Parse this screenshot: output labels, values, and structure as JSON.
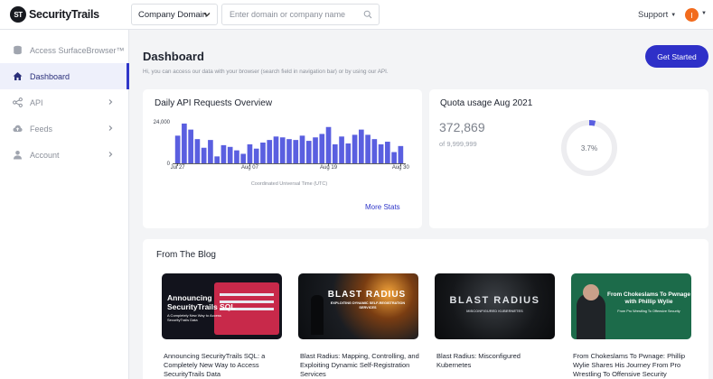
{
  "brand": {
    "name": "SecurityTrails",
    "mark": "ST"
  },
  "header": {
    "search_type": "Company Domain",
    "search_placeholder": "Enter domain or company name",
    "support_label": "Support",
    "avatar_initial": "I"
  },
  "sidebar": {
    "items": [
      {
        "label": "Access SurfaceBrowser™",
        "icon": "database-icon",
        "active": false
      },
      {
        "label": "Dashboard",
        "icon": "home-icon",
        "active": true
      },
      {
        "label": "API",
        "icon": "share-nodes-icon",
        "active": false
      },
      {
        "label": "Feeds",
        "icon": "cloud-upload-icon",
        "active": false
      },
      {
        "label": "Account",
        "icon": "user-icon",
        "active": false
      }
    ]
  },
  "page": {
    "title": "Dashboard",
    "subtitle": "Hi, you can access our data with your browser (search field in navigation bar) or by using our API.",
    "cta": "Get Started"
  },
  "api_card": {
    "title": "Daily API Requests Overview",
    "more_stats": "More Stats"
  },
  "quota_card": {
    "title": "Quota usage Aug 2021",
    "used": "372,869",
    "limit": "of 9,999,999",
    "percent_label": "3.7%",
    "percent": 3.7
  },
  "blog": {
    "title": "From The Blog",
    "posts": [
      {
        "caption": "Announcing SecurityTrails SQL: a Completely New Way to Access SecurityTrails Data",
        "thumb_title": "Announcing SecurityTrails SQL",
        "thumb_sub": "A Completely New Way to Access SecurityTrails Data"
      },
      {
        "caption": "Blast Radius: Mapping, Controlling, and Exploiting Dynamic Self-Registration Services",
        "thumb_title": "BLAST RADIUS",
        "thumb_sub": "EXPLOITING DYNAMIC SELF-REGISTRATION SERVICES"
      },
      {
        "caption": "Blast Radius: Misconfigured Kubernetes",
        "thumb_title": "BLAST RADIUS",
        "thumb_sub": "MISCONFIGURED KUBERNETES"
      },
      {
        "caption": "From Chokeslams To Pwnage: Phillip Wylie Shares His Journey From Pro Wrestling To Offensive Security",
        "thumb_title": "From Chokeslams To Pwnage with Phillip Wylie",
        "thumb_sub": "From Pro Wrestling To Offensive Security"
      }
    ]
  },
  "colors": {
    "accent": "#2e30c8",
    "bar": "#5a5fe0",
    "active_bg": "#eef0fb"
  },
  "chart_data": {
    "type": "bar",
    "xlabel": "Coordinated Universal Time (UTC)",
    "ylabel": "",
    "ylim": [
      0,
      24000
    ],
    "yticks": [
      "24,000",
      "0"
    ],
    "x_tick_labels": [
      "Jul 27",
      "Aug 07",
      "Aug 19",
      "Aug 30"
    ],
    "x_tick_index": [
      0,
      11,
      23,
      34
    ],
    "categories": [
      "Jul 27",
      "Jul 28",
      "Jul 29",
      "Jul 30",
      "Jul 31",
      "Aug 01",
      "Aug 02",
      "Aug 03",
      "Aug 04",
      "Aug 05",
      "Aug 06",
      "Aug 07",
      "Aug 08",
      "Aug 09",
      "Aug 10",
      "Aug 11",
      "Aug 12",
      "Aug 13",
      "Aug 14",
      "Aug 15",
      "Aug 16",
      "Aug 17",
      "Aug 18",
      "Aug 19",
      "Aug 20",
      "Aug 21",
      "Aug 22",
      "Aug 23",
      "Aug 24",
      "Aug 25",
      "Aug 26",
      "Aug 27",
      "Aug 28",
      "Aug 29",
      "Aug 30"
    ],
    "values": [
      16000,
      23000,
      19500,
      14000,
      9000,
      13500,
      4000,
      10500,
      9500,
      7500,
      5500,
      11000,
      8500,
      12000,
      13500,
      15500,
      15000,
      14000,
      13500,
      16000,
      13000,
      15000,
      17000,
      21000,
      11000,
      15500,
      11500,
      16500,
      19500,
      16500,
      14000,
      11000,
      12500,
      6500,
      10000
    ]
  }
}
